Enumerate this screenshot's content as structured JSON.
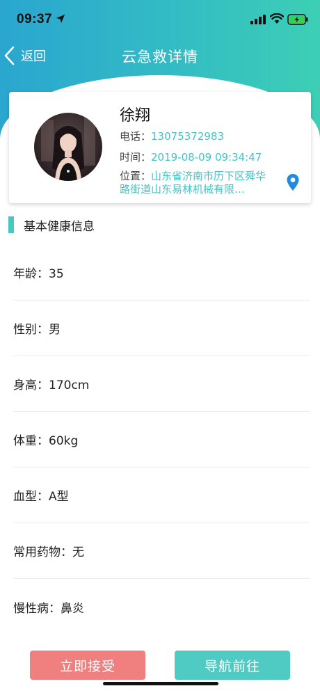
{
  "status_bar": {
    "time": "09:37"
  },
  "nav": {
    "back_label": "返回",
    "title": "云急救详情"
  },
  "profile": {
    "name": "徐翔",
    "phone_label": "电话：",
    "phone": "13075372983",
    "time_label": "时间：",
    "time": "2019-08-09 09:34:47",
    "location_label": "位置：",
    "location": "山东省济南市历下区舜华路街道山东易林机械有限…"
  },
  "section": {
    "title": "基本健康信息"
  },
  "health_rows": [
    "年龄：35",
    "性别：男",
    "身高：170cm",
    "体重：60kg",
    "血型：A型",
    "常用药物：无",
    "慢性病：鼻炎"
  ],
  "actions": {
    "accept_label": "立即接受",
    "navigate_label": "导航前往"
  },
  "colors": {
    "header_gradient_start": "#2aa6cf",
    "header_gradient_end": "#3dcfb5",
    "accent": "#45c2c4",
    "accept_button": "#f08080",
    "navigate_button": "#4fcbc4"
  },
  "icons": {
    "back": "chevron-left-icon",
    "location": "location-pin-icon",
    "signal": "cellular-signal-icon",
    "wifi": "wifi-icon",
    "battery": "battery-charging-icon",
    "location_services": "location-arrow-icon"
  }
}
